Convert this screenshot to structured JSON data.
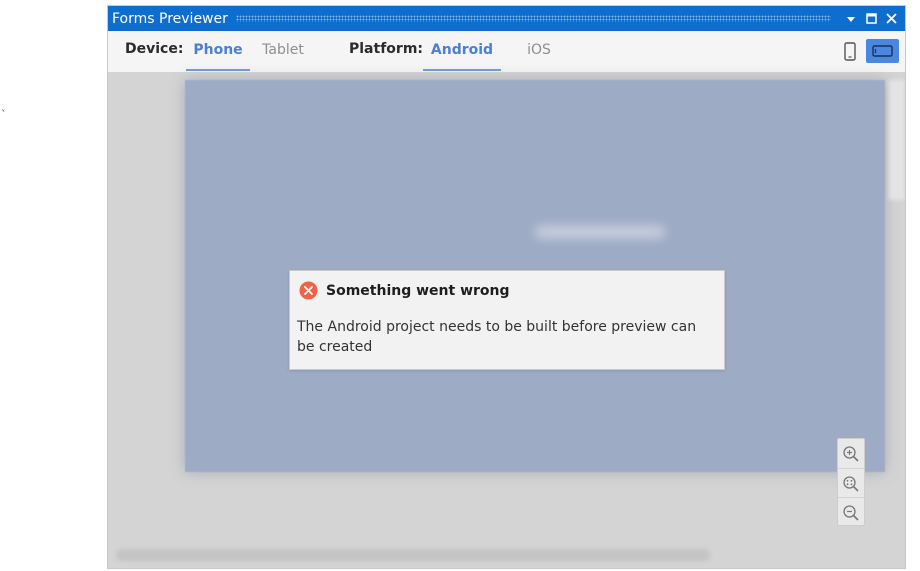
{
  "window": {
    "title": "Forms Previewer"
  },
  "toolbar": {
    "device_label": "Device:",
    "device_tabs": [
      {
        "label": "Phone",
        "active": true
      },
      {
        "label": "Tablet",
        "active": false
      }
    ],
    "platform_label": "Platform:",
    "platform_tabs": [
      {
        "label": "Android",
        "active": true
      },
      {
        "label": "iOS",
        "active": false
      }
    ],
    "orientation": {
      "options": [
        "portrait-icon",
        "landscape-icon"
      ],
      "selected": "landscape"
    }
  },
  "error": {
    "title": "Something went wrong",
    "message": "The Android project needs to be built before preview can be created"
  },
  "zoom_controls": [
    "zoom-in-icon",
    "zoom-fit-icon",
    "zoom-out-icon"
  ],
  "colors": {
    "titlebar": "#0e6ecf",
    "accent": "#4a7fd4",
    "error_icon": "#ee6448",
    "canvas": "#9eabc5"
  }
}
